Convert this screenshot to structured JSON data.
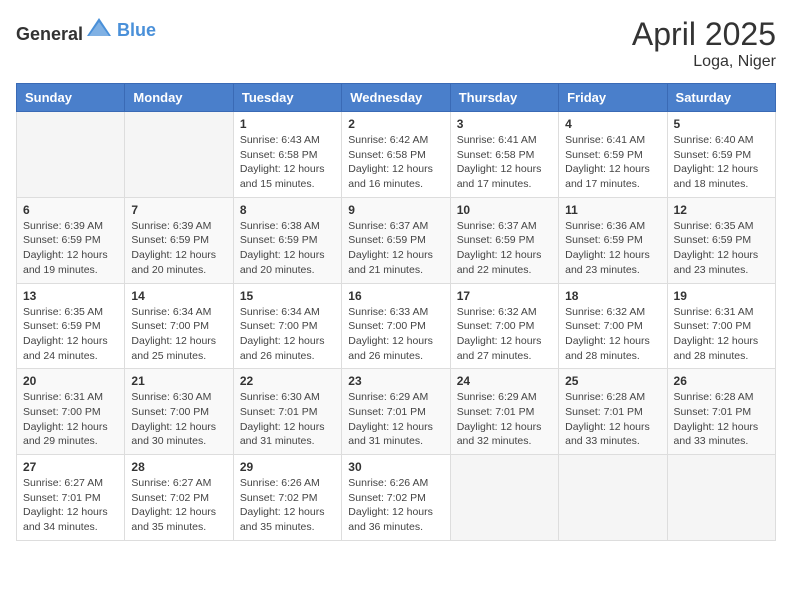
{
  "header": {
    "logo_general": "General",
    "logo_blue": "Blue",
    "title": "April 2025",
    "location": "Loga, Niger"
  },
  "days_of_week": [
    "Sunday",
    "Monday",
    "Tuesday",
    "Wednesday",
    "Thursday",
    "Friday",
    "Saturday"
  ],
  "weeks": [
    [
      {
        "day": "",
        "sunrise": "",
        "sunset": "",
        "daylight": ""
      },
      {
        "day": "",
        "sunrise": "",
        "sunset": "",
        "daylight": ""
      },
      {
        "day": "1",
        "sunrise": "Sunrise: 6:43 AM",
        "sunset": "Sunset: 6:58 PM",
        "daylight": "Daylight: 12 hours and 15 minutes."
      },
      {
        "day": "2",
        "sunrise": "Sunrise: 6:42 AM",
        "sunset": "Sunset: 6:58 PM",
        "daylight": "Daylight: 12 hours and 16 minutes."
      },
      {
        "day": "3",
        "sunrise": "Sunrise: 6:41 AM",
        "sunset": "Sunset: 6:58 PM",
        "daylight": "Daylight: 12 hours and 17 minutes."
      },
      {
        "day": "4",
        "sunrise": "Sunrise: 6:41 AM",
        "sunset": "Sunset: 6:59 PM",
        "daylight": "Daylight: 12 hours and 17 minutes."
      },
      {
        "day": "5",
        "sunrise": "Sunrise: 6:40 AM",
        "sunset": "Sunset: 6:59 PM",
        "daylight": "Daylight: 12 hours and 18 minutes."
      }
    ],
    [
      {
        "day": "6",
        "sunrise": "Sunrise: 6:39 AM",
        "sunset": "Sunset: 6:59 PM",
        "daylight": "Daylight: 12 hours and 19 minutes."
      },
      {
        "day": "7",
        "sunrise": "Sunrise: 6:39 AM",
        "sunset": "Sunset: 6:59 PM",
        "daylight": "Daylight: 12 hours and 20 minutes."
      },
      {
        "day": "8",
        "sunrise": "Sunrise: 6:38 AM",
        "sunset": "Sunset: 6:59 PM",
        "daylight": "Daylight: 12 hours and 20 minutes."
      },
      {
        "day": "9",
        "sunrise": "Sunrise: 6:37 AM",
        "sunset": "Sunset: 6:59 PM",
        "daylight": "Daylight: 12 hours and 21 minutes."
      },
      {
        "day": "10",
        "sunrise": "Sunrise: 6:37 AM",
        "sunset": "Sunset: 6:59 PM",
        "daylight": "Daylight: 12 hours and 22 minutes."
      },
      {
        "day": "11",
        "sunrise": "Sunrise: 6:36 AM",
        "sunset": "Sunset: 6:59 PM",
        "daylight": "Daylight: 12 hours and 23 minutes."
      },
      {
        "day": "12",
        "sunrise": "Sunrise: 6:35 AM",
        "sunset": "Sunset: 6:59 PM",
        "daylight": "Daylight: 12 hours and 23 minutes."
      }
    ],
    [
      {
        "day": "13",
        "sunrise": "Sunrise: 6:35 AM",
        "sunset": "Sunset: 6:59 PM",
        "daylight": "Daylight: 12 hours and 24 minutes."
      },
      {
        "day": "14",
        "sunrise": "Sunrise: 6:34 AM",
        "sunset": "Sunset: 7:00 PM",
        "daylight": "Daylight: 12 hours and 25 minutes."
      },
      {
        "day": "15",
        "sunrise": "Sunrise: 6:34 AM",
        "sunset": "Sunset: 7:00 PM",
        "daylight": "Daylight: 12 hours and 26 minutes."
      },
      {
        "day": "16",
        "sunrise": "Sunrise: 6:33 AM",
        "sunset": "Sunset: 7:00 PM",
        "daylight": "Daylight: 12 hours and 26 minutes."
      },
      {
        "day": "17",
        "sunrise": "Sunrise: 6:32 AM",
        "sunset": "Sunset: 7:00 PM",
        "daylight": "Daylight: 12 hours and 27 minutes."
      },
      {
        "day": "18",
        "sunrise": "Sunrise: 6:32 AM",
        "sunset": "Sunset: 7:00 PM",
        "daylight": "Daylight: 12 hours and 28 minutes."
      },
      {
        "day": "19",
        "sunrise": "Sunrise: 6:31 AM",
        "sunset": "Sunset: 7:00 PM",
        "daylight": "Daylight: 12 hours and 28 minutes."
      }
    ],
    [
      {
        "day": "20",
        "sunrise": "Sunrise: 6:31 AM",
        "sunset": "Sunset: 7:00 PM",
        "daylight": "Daylight: 12 hours and 29 minutes."
      },
      {
        "day": "21",
        "sunrise": "Sunrise: 6:30 AM",
        "sunset": "Sunset: 7:00 PM",
        "daylight": "Daylight: 12 hours and 30 minutes."
      },
      {
        "day": "22",
        "sunrise": "Sunrise: 6:30 AM",
        "sunset": "Sunset: 7:01 PM",
        "daylight": "Daylight: 12 hours and 31 minutes."
      },
      {
        "day": "23",
        "sunrise": "Sunrise: 6:29 AM",
        "sunset": "Sunset: 7:01 PM",
        "daylight": "Daylight: 12 hours and 31 minutes."
      },
      {
        "day": "24",
        "sunrise": "Sunrise: 6:29 AM",
        "sunset": "Sunset: 7:01 PM",
        "daylight": "Daylight: 12 hours and 32 minutes."
      },
      {
        "day": "25",
        "sunrise": "Sunrise: 6:28 AM",
        "sunset": "Sunset: 7:01 PM",
        "daylight": "Daylight: 12 hours and 33 minutes."
      },
      {
        "day": "26",
        "sunrise": "Sunrise: 6:28 AM",
        "sunset": "Sunset: 7:01 PM",
        "daylight": "Daylight: 12 hours and 33 minutes."
      }
    ],
    [
      {
        "day": "27",
        "sunrise": "Sunrise: 6:27 AM",
        "sunset": "Sunset: 7:01 PM",
        "daylight": "Daylight: 12 hours and 34 minutes."
      },
      {
        "day": "28",
        "sunrise": "Sunrise: 6:27 AM",
        "sunset": "Sunset: 7:02 PM",
        "daylight": "Daylight: 12 hours and 35 minutes."
      },
      {
        "day": "29",
        "sunrise": "Sunrise: 6:26 AM",
        "sunset": "Sunset: 7:02 PM",
        "daylight": "Daylight: 12 hours and 35 minutes."
      },
      {
        "day": "30",
        "sunrise": "Sunrise: 6:26 AM",
        "sunset": "Sunset: 7:02 PM",
        "daylight": "Daylight: 12 hours and 36 minutes."
      },
      {
        "day": "",
        "sunrise": "",
        "sunset": "",
        "daylight": ""
      },
      {
        "day": "",
        "sunrise": "",
        "sunset": "",
        "daylight": ""
      },
      {
        "day": "",
        "sunrise": "",
        "sunset": "",
        "daylight": ""
      }
    ]
  ]
}
